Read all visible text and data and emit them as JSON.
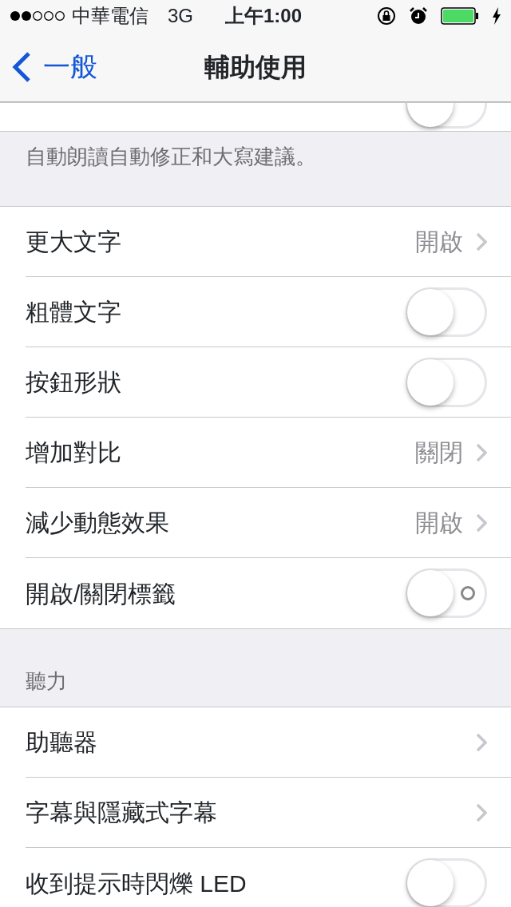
{
  "status_bar": {
    "carrier": "中華電信",
    "network": "3G",
    "time": "上午1:00"
  },
  "nav": {
    "back": "一般",
    "title": "輔助使用"
  },
  "sections": [
    {
      "rows": [
        {
          "kind": "cut_toggle",
          "on": false,
          "label_ring": false
        }
      ],
      "footer": "自動朗讀自動修正和大寫建議。"
    },
    {
      "rows": [
        {
          "kind": "link",
          "label": "更大文字",
          "value": "開啟"
        },
        {
          "kind": "toggle",
          "label": "粗體文字",
          "on": false,
          "label_ring": false
        },
        {
          "kind": "toggle",
          "label": "按鈕形狀",
          "on": false,
          "label_ring": false
        },
        {
          "kind": "link",
          "label": "增加對比",
          "value": "關閉"
        },
        {
          "kind": "link",
          "label": "減少動態效果",
          "value": "開啟"
        },
        {
          "kind": "toggle",
          "label": "開啟/關閉標籤",
          "on": false,
          "label_ring": true
        }
      ]
    },
    {
      "header": "聽力",
      "rows": [
        {
          "kind": "link",
          "label": "助聽器"
        },
        {
          "kind": "link",
          "label": "字幕與隱藏式字幕"
        },
        {
          "kind": "toggle",
          "label": "收到提示時閃爍 LED",
          "on": false,
          "label_ring": false
        }
      ]
    }
  ]
}
